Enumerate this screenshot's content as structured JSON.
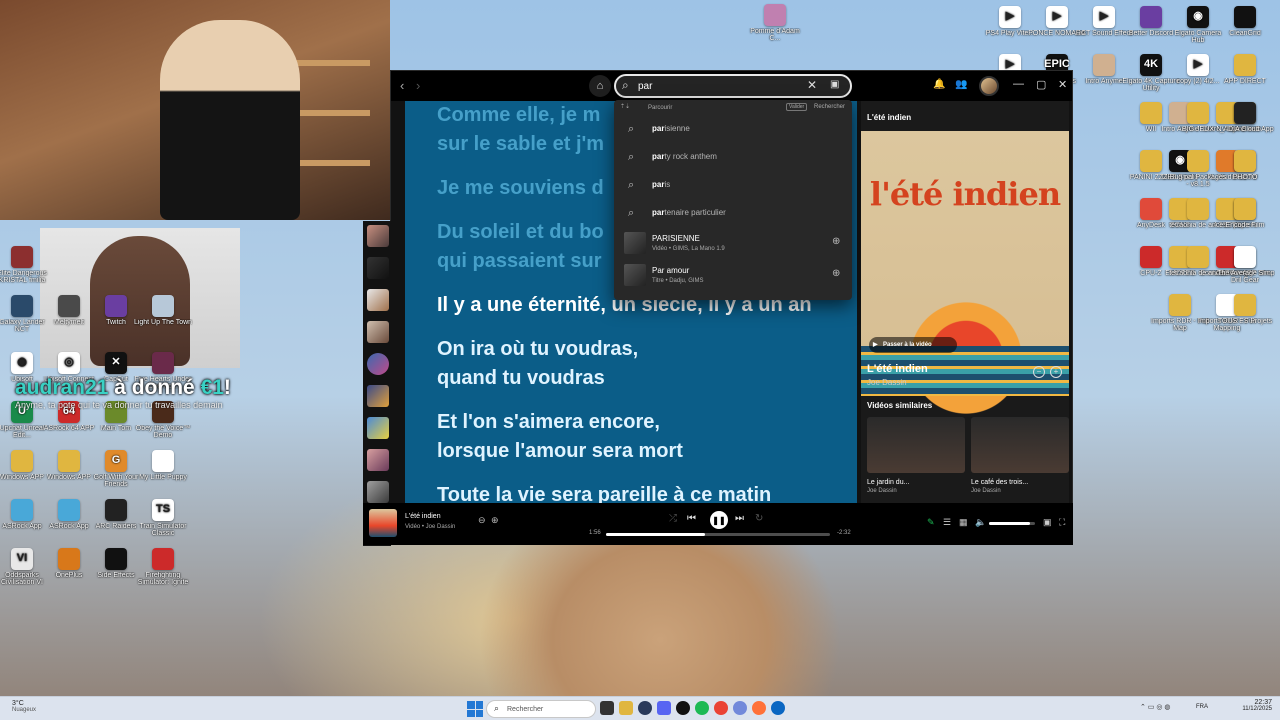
{
  "desktop": {
    "top_center_icon": "Pomme d'Adam C...",
    "left_icons": [
      {
        "label": "Elite Dangerous KRISTAL fmilia",
        "color": "#8c2f2f",
        "glyph": ""
      },
      {
        "label": "Insectoid Giant AO",
        "color": "#3b2a7a",
        "glyph": ""
      },
      {
        "label": "OneLaunch",
        "color": "#1a1a1a",
        "glyph": "◎"
      },
      {
        "label": "ASRock APP Shop",
        "color": "#cfcfcf",
        "glyph": ""
      },
      {
        "label": "Galaxy Lander NCT",
        "color": "#2a4a6a",
        "glyph": ""
      },
      {
        "label": "Meltymelt",
        "color": "#4a4a4a",
        "glyph": ""
      },
      {
        "label": "Twitch",
        "color": "#6a3ea1",
        "glyph": ""
      },
      {
        "label": "Light Up The Town",
        "color": "#b7c8d8",
        "glyph": ""
      },
      {
        "label": "Ubisoft",
        "color": "#ffffff",
        "glyph": "◉"
      },
      {
        "label": "Ubisoft Connect",
        "color": "#ffffff",
        "glyph": "◎"
      },
      {
        "label": "CapCut",
        "color": "#111",
        "glyph": "✕"
      },
      {
        "label": "Five Hearts Under One Ro...",
        "color": "#6a2a4a",
        "glyph": ""
      },
      {
        "label": "Upchat Unreal Edit...",
        "color": "#1a8a4a",
        "glyph": "U"
      },
      {
        "label": "ASRock 64 APP",
        "color": "#cc2a2a",
        "glyph": "64"
      },
      {
        "label": "Main Tom",
        "color": "#6b8a2a",
        "glyph": ""
      },
      {
        "label": "Obey the Voice™ Demo",
        "color": "#4a2a1a",
        "glyph": ""
      },
      {
        "label": "Windows APP",
        "color": "#e0b640",
        "glyph": ""
      },
      {
        "label": "Windows APP",
        "color": "#e0b640",
        "glyph": ""
      },
      {
        "label": "Golf With Your Friends",
        "color": "#e08a2a",
        "glyph": "G"
      },
      {
        "label": "My Little Puppy",
        "color": "#ffffff",
        "glyph": ""
      },
      {
        "label": "ASRock App",
        "color": "#49a8d8",
        "glyph": ""
      },
      {
        "label": "ASRock App",
        "color": "#49a8d8",
        "glyph": ""
      },
      {
        "label": "ARC Raiders",
        "color": "#222",
        "glyph": ""
      },
      {
        "label": "Train Simulator Classic",
        "color": "#ffffff",
        "glyph": "TS"
      },
      {
        "label": "Oddsparks Civilisation VI",
        "color": "#e8e8e8",
        "glyph": "VI"
      },
      {
        "label": "OnePlus",
        "color": "#d8781a",
        "glyph": ""
      },
      {
        "label": "Side Effects",
        "color": "#111",
        "glyph": ""
      },
      {
        "label": "Firefighting Simulator: Ignite",
        "color": "#cc2a2a",
        "glyph": ""
      }
    ],
    "right_icons": [
      {
        "label": "PS4 Play Vite...",
        "color": "#ffffff",
        "glyph": "▶"
      },
      {
        "label": "PONCE NOMADA",
        "color": "#ffffff",
        "glyph": "▶"
      },
      {
        "label": "RCT Sound Effect",
        "color": "#ffffff",
        "glyph": "▶"
      },
      {
        "label": "Better Discord",
        "color": "#6a3ea1",
        "glyph": ""
      },
      {
        "label": "Elgato Camera Hub",
        "color": "#111",
        "glyph": "◉"
      },
      {
        "label": "CleanGrid",
        "color": "#111",
        "glyph": ""
      },
      {
        "label": "EA FC FOOTBALL CL...",
        "color": "#ffffff",
        "glyph": "▶"
      },
      {
        "label": "Epic Games Launcher",
        "color": "#111",
        "glyph": "EPIC"
      },
      {
        "label": "Intro Anyme",
        "color": "#d0b090",
        "glyph": ""
      },
      {
        "label": "Elgato 4K Capture Utility",
        "color": "#111",
        "glyph": "4K"
      },
      {
        "label": "copy (2) 4/2...",
        "color": "#ffffff",
        "glyph": "▶"
      },
      {
        "label": "APP DIRECT",
        "color": "#e0b640",
        "glyph": ""
      },
      {
        "label": "Intro Anyme",
        "color": "#d0b090",
        "glyph": ""
      },
      {
        "label": "Outro_Anyme...",
        "color": "#e0b640",
        "glyph": ""
      },
      {
        "label": "Ibn el kalb",
        "color": "#e0b640",
        "glyph": ""
      },
      {
        "label": "WII",
        "color": "#e0b640",
        "glyph": ""
      },
      {
        "label": "BIG JEUX",
        "color": "#e0b640",
        "glyph": ""
      },
      {
        "label": "NVIDIA Cloud App",
        "color": "#222",
        "glyph": ""
      },
      {
        "label": "OBS Studio",
        "color": "#111",
        "glyph": "◉"
      },
      {
        "label": "FL Studio 21",
        "color": "#e07a2a",
        "glyph": ""
      },
      {
        "label": "Discord",
        "color": "#6a3ea1",
        "glyph": ""
      },
      {
        "label": "PANINI ZZZP",
        "color": "#e0b640",
        "glyph": ""
      },
      {
        "label": "Bug pal Packages - v8.1.5",
        "color": "#e0b640",
        "glyph": ""
      },
      {
        "label": "PHOTO",
        "color": "#e0b640",
        "glyph": ""
      },
      {
        "label": "SONS",
        "color": "#e0b640",
        "glyph": ""
      },
      {
        "label": "ASSETS",
        "color": "#e0b640",
        "glyph": ""
      },
      {
        "label": "papiers",
        "color": "#e0b640",
        "glyph": ""
      },
      {
        "label": "AnyDesk",
        "color": "#e04a3a",
        "glyph": ""
      },
      {
        "label": "tetraonia de ances",
        "color": "#e0b640",
        "glyph": ""
      },
      {
        "label": "Encode Film",
        "color": "#e0b640",
        "glyph": ""
      },
      {
        "label": "EMOTES",
        "color": "#e0b640",
        "glyph": ""
      },
      {
        "label": "Content Manager",
        "color": "#cc2a2a",
        "glyph": ""
      },
      {
        "label": "ASRock APP Shop",
        "color": "#49a8d8",
        "glyph": ""
      },
      {
        "label": "CPU-Z",
        "color": "#cc2a2a",
        "glyph": ""
      },
      {
        "label": "tetraonia de ances",
        "color": "#e0b640",
        "glyph": ""
      },
      {
        "label": "The Average Sim. Dril Gear",
        "color": "#ffffff",
        "glyph": ""
      },
      {
        "label": "Imports RDR - Full Map",
        "color": "#e0b640",
        "glyph": ""
      },
      {
        "label": "Imports RDR - Full Mapping",
        "color": "#ffffff",
        "glyph": ""
      },
      {
        "label": "TOUS ES Projets",
        "color": "#e0b640",
        "glyph": ""
      }
    ]
  },
  "donation": {
    "user": "audran21",
    "text": " à donné ",
    "amount": "€1",
    "bang": "!",
    "message": "Anyme, ta pote qui te va donner tu travailles demain"
  },
  "spotify": {
    "search": {
      "value": "par",
      "placeholder": "Que souhaitez-vous écouter ou regarder ?"
    },
    "dropdown": {
      "browse_label": "Parcourir",
      "validate_label": "Valider",
      "search_label": "Rechercher",
      "suggestions": [
        {
          "match": "par",
          "rest": "isienne"
        },
        {
          "match": "par",
          "rest": "ty rock anthem"
        },
        {
          "match": "par",
          "rest": "is"
        },
        {
          "match": "par",
          "rest": "tenaire particulier"
        }
      ],
      "results": [
        {
          "title": "PARISIENNE",
          "subtitle": "Vidéo • GIMS, La Mano 1.9"
        },
        {
          "title": "Par amour",
          "subtitle": "Titre • Dadju, GIMS"
        }
      ]
    },
    "lyrics": [
      {
        "text": "Comme elle, je m",
        "state": "past"
      },
      {
        "text": "sur le sable et j'm",
        "state": "past"
      },
      {
        "text": "Je me souviens d",
        "state": "past"
      },
      {
        "text": "Du soleil et du bo",
        "state": "past"
      },
      {
        "text": "qui passaient sur",
        "state": "past"
      },
      {
        "text": "Il y a une éternité, un siècle, il y a un an",
        "state": "cur"
      },
      {
        "text": "On ira où tu voudras,",
        "state": "fut"
      },
      {
        "text": "quand tu voudras",
        "state": "fut"
      },
      {
        "text": "Et l'on s'aimera encore,",
        "state": "fut"
      },
      {
        "text": "lorsque l'amour sera mort",
        "state": "fut"
      },
      {
        "text": "Toute la vie sera pareille à ce matin",
        "state": "fut"
      }
    ],
    "now_playing": {
      "header": "L'été indien",
      "cover_title": "l'été indien",
      "video_button": "Passer à la vidéo",
      "title": "L'été indien",
      "artist": "Joe Dassin",
      "similar_heading": "Vidéos similaires",
      "similar": [
        {
          "title": "Le jardin du...",
          "artist": "Joe Dassin"
        },
        {
          "title": "Le café des trois...",
          "artist": "Joe Dassin"
        }
      ]
    },
    "player": {
      "title": "L'été indien",
      "subtitle": "Vidéo • Joe Dassin",
      "elapsed": "1:56",
      "remaining": "-2:32",
      "progress": 0.44,
      "volume": 0.9
    }
  },
  "taskbar": {
    "weather_temp": "3°C",
    "weather_cond": "Nuageux",
    "search_placeholder": "Rechercher",
    "lang": "FRA",
    "time": "22:37",
    "date": "11/12/2025"
  }
}
